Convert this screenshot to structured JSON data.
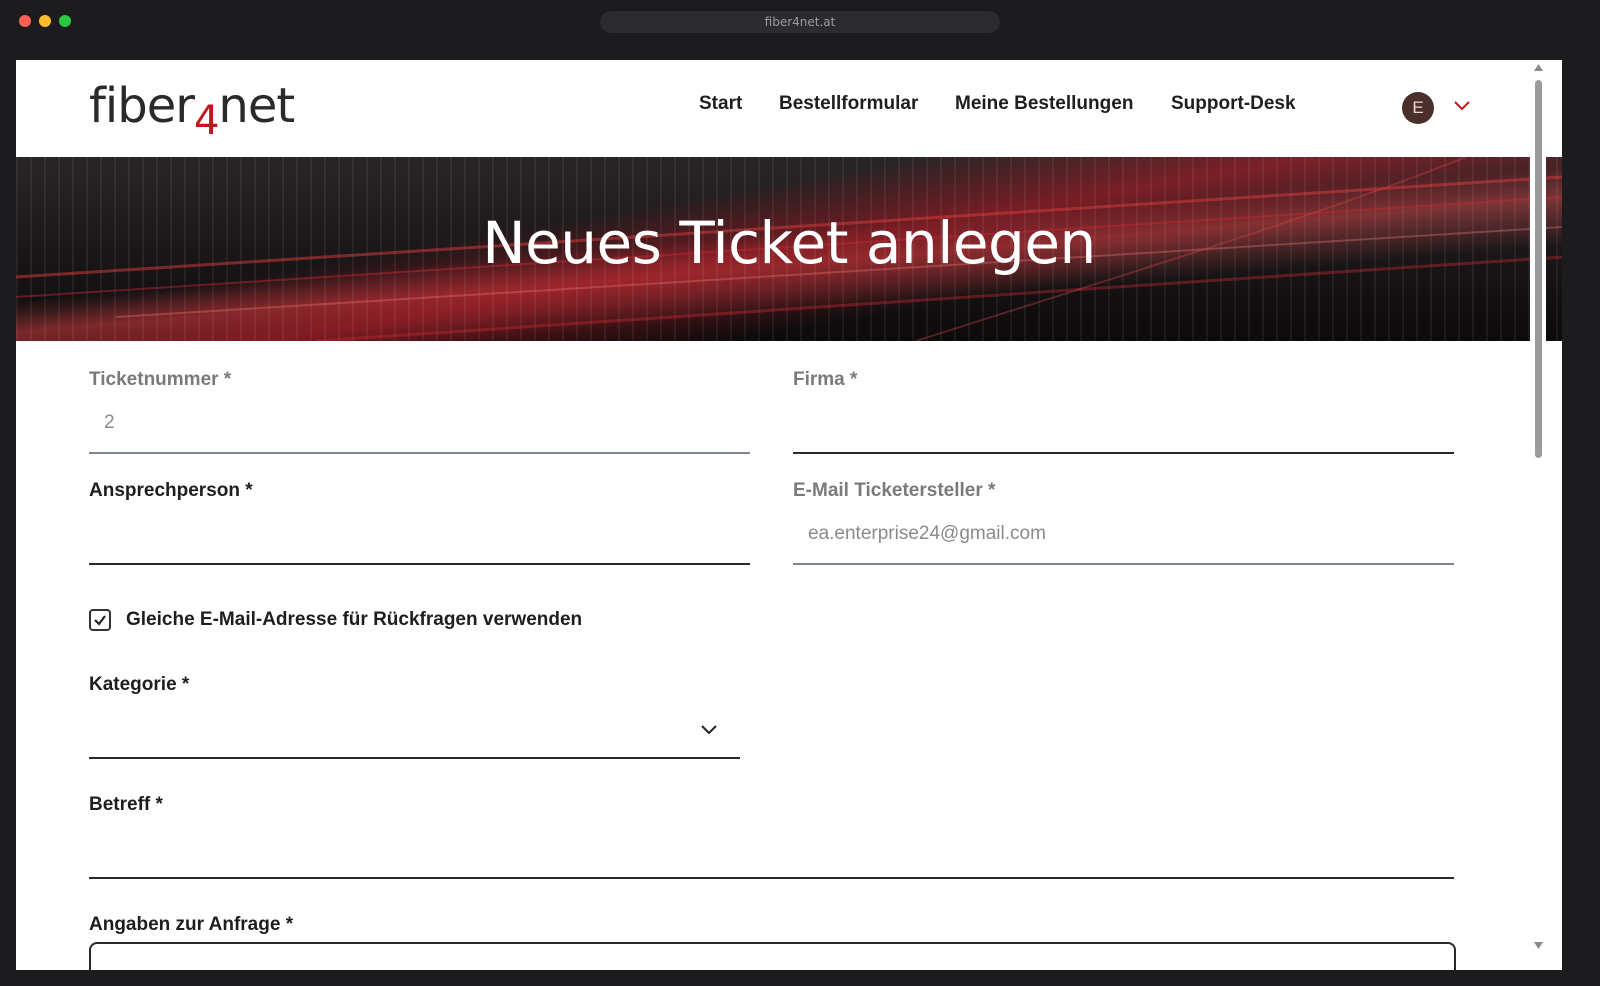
{
  "browser": {
    "url": "fiber4net.at"
  },
  "header": {
    "logo": {
      "part1": "fiber",
      "part2": "4",
      "part3": "net"
    },
    "nav": [
      {
        "label": "Start"
      },
      {
        "label": "Bestellformular"
      },
      {
        "label": "Meine Bestellungen"
      },
      {
        "label": "Support-Desk"
      }
    ],
    "avatar_initial": "E"
  },
  "hero": {
    "title": "Neues Ticket anlegen"
  },
  "form": {
    "ticketnummer": {
      "label": "Ticketnummer *",
      "value": "2"
    },
    "firma": {
      "label": "Firma *",
      "value": ""
    },
    "ansprechperson": {
      "label": "Ansprechperson *",
      "value": ""
    },
    "email": {
      "label": "E-Mail Ticketersteller *",
      "value": "ea.enterprise24@gmail.com"
    },
    "same_email": {
      "label": "Gleiche E-Mail-Adresse für Rückfragen verwenden",
      "checked": true
    },
    "kategorie": {
      "label": "Kategorie *",
      "value": ""
    },
    "betreff": {
      "label": "Betreff *",
      "value": ""
    },
    "angaben": {
      "label": "Angaben zur Anfrage *"
    }
  }
}
